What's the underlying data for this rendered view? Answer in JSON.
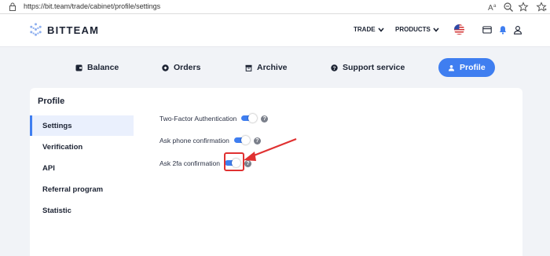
{
  "browser": {
    "url": "https://bit.team/trade/cabinet/profile/settings"
  },
  "header": {
    "logo_text": "BITTEAM",
    "trade_label": "TRADE",
    "products_label": "PRODUCTS",
    "accent": "#3f7ef0"
  },
  "tabs": [
    {
      "label": "Balance",
      "icon": "wallet-icon"
    },
    {
      "label": "Orders",
      "icon": "orders-icon"
    },
    {
      "label": "Archive",
      "icon": "archive-icon"
    },
    {
      "label": "Support service",
      "icon": "help-icon"
    },
    {
      "label": "Profile",
      "icon": "user-icon",
      "active": true
    }
  ],
  "profile": {
    "title": "Profile",
    "menu": [
      "Settings",
      "Verification",
      "API",
      "Referral program",
      "Statistic"
    ],
    "active_item": "Settings"
  },
  "settings": [
    {
      "label": "Two-Factor Authentication",
      "enabled": true
    },
    {
      "label": "Ask phone confirmation",
      "enabled": true
    },
    {
      "label": "Ask 2fa confirmation",
      "enabled": true
    }
  ],
  "annotation": {
    "color": "#e03131"
  }
}
